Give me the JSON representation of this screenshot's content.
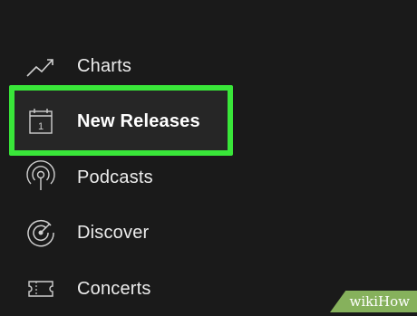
{
  "menu": {
    "items": [
      {
        "label": "Charts",
        "icon": "trending-up-icon"
      },
      {
        "label": "New Releases",
        "icon": "calendar-icon",
        "icon_day": "1",
        "highlighted": true
      },
      {
        "label": "Podcasts",
        "icon": "podcast-icon"
      },
      {
        "label": "Discover",
        "icon": "discover-radar-icon"
      },
      {
        "label": "Concerts",
        "icon": "ticket-icon"
      }
    ]
  },
  "colors": {
    "background": "#1a1a1a",
    "highlight_border": "#39e639",
    "text": "#ececec",
    "watermark": "#86b15c"
  },
  "watermark": {
    "text": "wikiHow"
  }
}
